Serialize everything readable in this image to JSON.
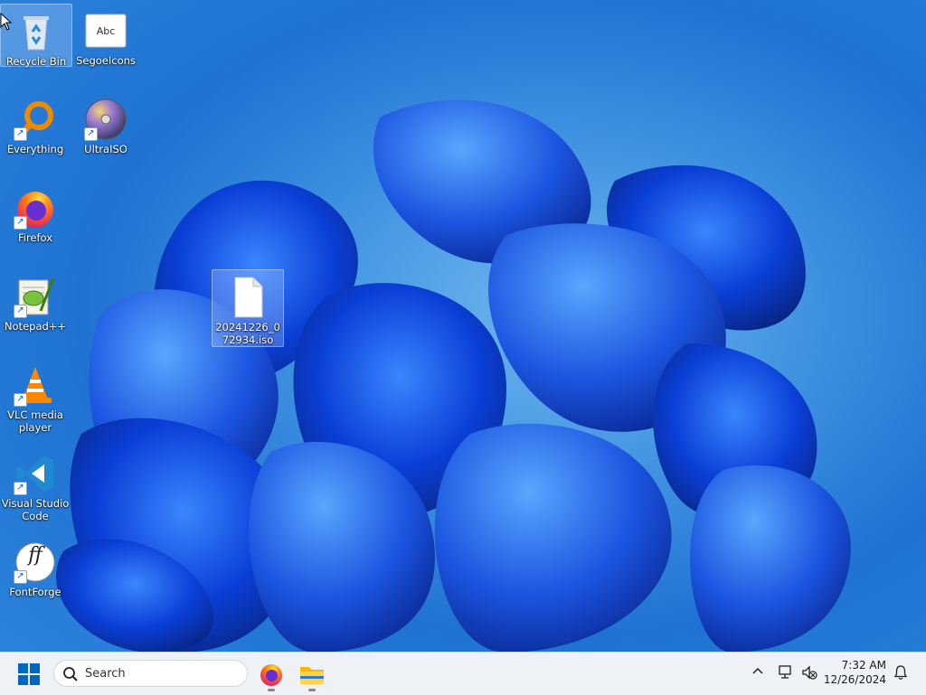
{
  "desktop": {
    "icons": [
      {
        "label": "Recycle Bin",
        "icon": "recycle-bin-icon"
      },
      {
        "label": "SegoeIcons",
        "icon": "font-file-icon",
        "glyph": "Abc"
      },
      {
        "label": "Everything",
        "icon": "everything-search-icon"
      },
      {
        "label": "UltraISO",
        "icon": "disc-icon"
      },
      {
        "label": "Firefox",
        "icon": "firefox-icon"
      },
      {
        "label": "Notepad++",
        "icon": "notepad-plus-plus-icon"
      },
      {
        "label": "VLC media player",
        "icon": "vlc-cone-icon"
      },
      {
        "label": "Visual Studio Code",
        "icon": "vscode-icon"
      },
      {
        "label": "FontForge",
        "icon": "fontforge-icon",
        "glyph": "ff"
      },
      {
        "label": "20241226_072934.iso",
        "icon": "blank-file-icon"
      }
    ]
  },
  "taskbar": {
    "search_label": "Search",
    "pinned": [
      "firefox-icon",
      "file-explorer-icon"
    ],
    "clock_time": "7:32 AM",
    "clock_date": "12/26/2024"
  },
  "colors": {
    "accent": "#0067c0",
    "taskbar_bg": "#eef1f6"
  }
}
